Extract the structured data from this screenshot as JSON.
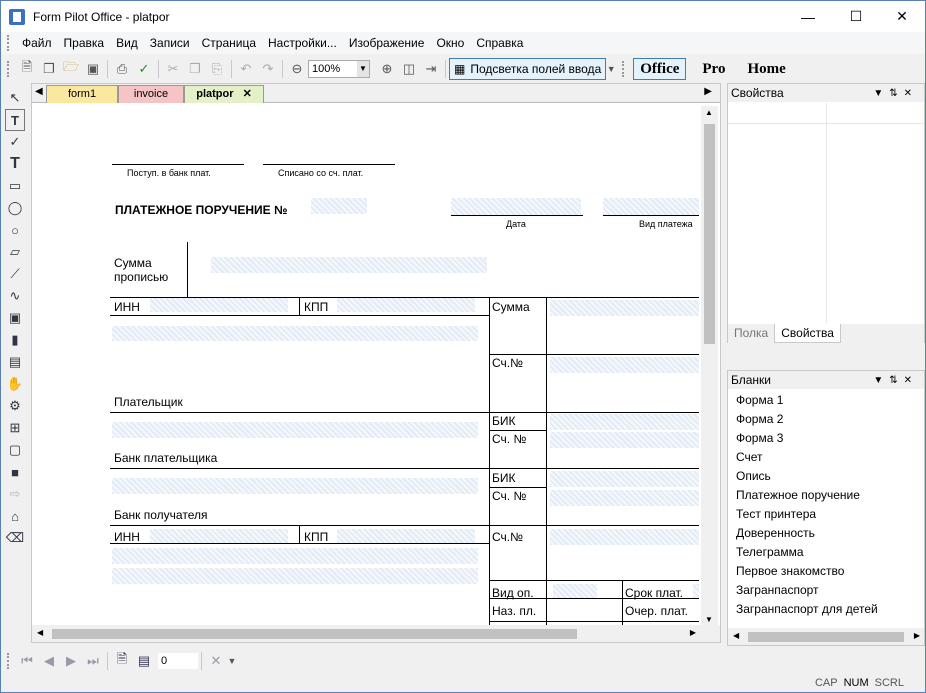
{
  "app": {
    "title": "Form Pilot Office - platpor"
  },
  "menu": [
    "Файл",
    "Правка",
    "Вид",
    "Записи",
    "Страница",
    "Настройки...",
    "Изображение",
    "Окно",
    "Справка"
  ],
  "toolbar": {
    "zoom": "100%",
    "highlight_label": "Подсветка полей ввода",
    "editions": [
      "Office",
      "Pro",
      "Home"
    ]
  },
  "tabs": [
    "form1",
    "invoice",
    "platpor"
  ],
  "form": {
    "bank_received": "Поступ. в банк плат.",
    "debited": "Списано со сч. плат.",
    "title": "ПЛАТЕЖНОЕ ПОРУЧЕНИЕ №",
    "date": "Дата",
    "payment_type": "Вид платежа",
    "sum_words_1": "Сумма",
    "sum_words_2": "прописью",
    "inn": "ИНН",
    "kpp": "КПП",
    "sum": "Сумма",
    "acc_no": "Сч.№",
    "payer": "Плательщик",
    "bik": "БИК",
    "acc_no2": "Сч. №",
    "payer_bank": "Банк плательщика",
    "recipient_bank": "Банк получателя",
    "op_type": "Вид оп.",
    "purpose": "Наз. пл.",
    "term": "Срок плат.",
    "order": "Очер. плат."
  },
  "properties": {
    "title": "Свойства",
    "tabs": [
      "Полка",
      "Свойства"
    ]
  },
  "blanks": {
    "title": "Бланки",
    "items": [
      "Форма 1",
      "Форма 2",
      "Форма 3",
      "Счет",
      "Опись",
      "Платежное поручение",
      "Тест принтера",
      "Доверенность",
      "Телеграмма",
      "Первое знакомство",
      "Загранпаспорт",
      "Загранпаспорт для детей"
    ]
  },
  "nav": {
    "page": "0"
  },
  "status": [
    "CAP",
    "NUM",
    "SCRL"
  ]
}
